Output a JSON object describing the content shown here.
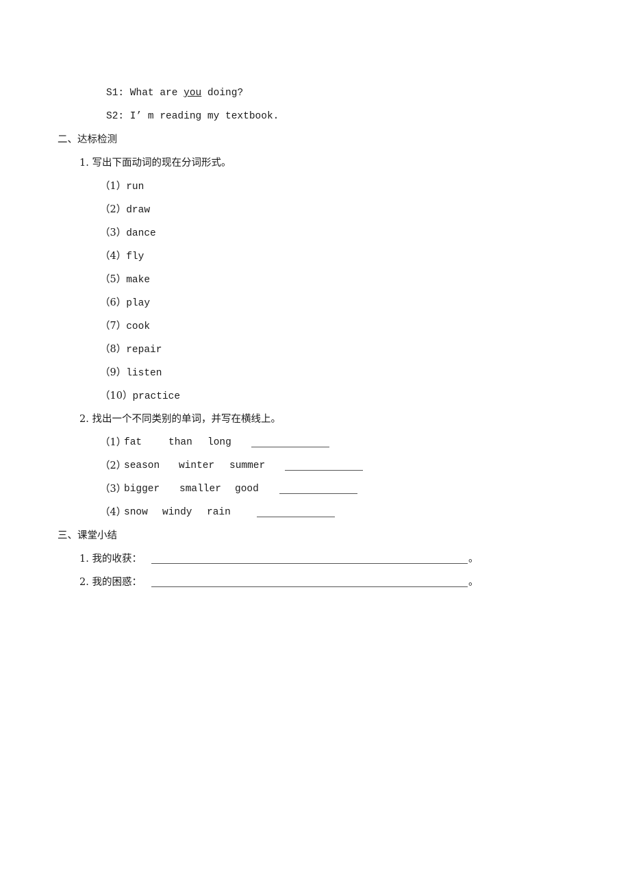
{
  "dialogue": {
    "s1_prefix": "S1: What are ",
    "s1_underlined": "you",
    "s1_suffix": " doing?",
    "s2": "S2: I’ m reading my textbook."
  },
  "section2": {
    "heading": "二、达标检测",
    "q1": {
      "title": "1. 写出下面动词的现在分词形式。",
      "items": [
        {
          "num": "（1）",
          "word": "run"
        },
        {
          "num": "（2）",
          "word": "draw"
        },
        {
          "num": "（3）",
          "word": "dance"
        },
        {
          "num": "（4）",
          "word": "fly"
        },
        {
          "num": "（5）",
          "word": "make"
        },
        {
          "num": "（6）",
          "word": "play"
        },
        {
          "num": "（7）",
          "word": "cook"
        },
        {
          "num": "（8）",
          "word": "repair"
        },
        {
          "num": "（9）",
          "word": "listen"
        },
        {
          "num": "（10）",
          "word": "practice"
        }
      ]
    },
    "q2": {
      "title": "2. 找出一个不同类别的单词，并写在横线上。",
      "items": [
        {
          "num": "（1）",
          "words": [
            "fat",
            "than",
            "long"
          ],
          "answer": ""
        },
        {
          "num": "（2）",
          "words": [
            "season",
            "winter",
            "summer"
          ],
          "answer": ""
        },
        {
          "num": "（3）",
          "words": [
            "bigger",
            "smaller",
            "good"
          ],
          "answer": ""
        },
        {
          "num": "（4）",
          "words": [
            "snow",
            "windy",
            "rain"
          ],
          "answer": ""
        }
      ]
    }
  },
  "section3": {
    "heading": "三、课堂小结",
    "items": [
      {
        "label": "1. 我的收获：",
        "answer": "",
        "end": "。"
      },
      {
        "label": "2. 我的困惑：",
        "answer": "",
        "end": "。"
      }
    ]
  }
}
